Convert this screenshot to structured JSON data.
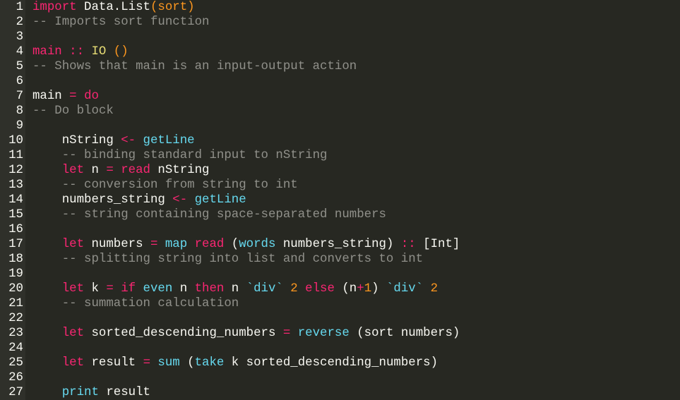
{
  "editor": {
    "line_numbers": [
      "1",
      "2",
      "3",
      "4",
      "5",
      "6",
      "7",
      "8",
      "9",
      "10",
      "11",
      "12",
      "13",
      "14",
      "15",
      "16",
      "17",
      "18",
      "19",
      "20",
      "21",
      "22",
      "23",
      "24",
      "25",
      "26",
      "27"
    ],
    "lines": [
      [
        {
          "t": "import",
          "c": "kw"
        },
        {
          "t": " Data.List",
          "c": "plain"
        },
        {
          "t": "(sort)",
          "c": "num"
        }
      ],
      [
        {
          "t": "-- Imports sort function",
          "c": "comment"
        }
      ],
      [],
      [
        {
          "t": "main",
          "c": "kw"
        },
        {
          "t": " :: ",
          "c": "op"
        },
        {
          "t": "IO",
          "c": "ty"
        },
        {
          "t": " ()",
          "c": "num"
        }
      ],
      [
        {
          "t": "-- Shows that main is an input-output action",
          "c": "comment"
        }
      ],
      [],
      [
        {
          "t": "main",
          "c": "plain"
        },
        {
          "t": " = ",
          "c": "op"
        },
        {
          "t": "do",
          "c": "kw"
        }
      ],
      [
        {
          "t": "-- Do block",
          "c": "comment"
        }
      ],
      [],
      [
        {
          "t": "    nString ",
          "c": "plain"
        },
        {
          "t": "<-",
          "c": "op"
        },
        {
          "t": " getLine",
          "c": "fn"
        }
      ],
      [
        {
          "t": "    -- binding standard input to nString",
          "c": "comment"
        }
      ],
      [
        {
          "t": "    let",
          "c": "kw"
        },
        {
          "t": " n ",
          "c": "plain"
        },
        {
          "t": "=",
          "c": "op"
        },
        {
          "t": " read",
          "c": "kw"
        },
        {
          "t": " nString",
          "c": "plain"
        }
      ],
      [
        {
          "t": "    -- conversion from string to int",
          "c": "comment"
        }
      ],
      [
        {
          "t": "    numbers_string ",
          "c": "plain"
        },
        {
          "t": "<-",
          "c": "op"
        },
        {
          "t": " getLine",
          "c": "fn"
        }
      ],
      [
        {
          "t": "    -- string containing space-separated numbers",
          "c": "comment"
        }
      ],
      [],
      [
        {
          "t": "    let",
          "c": "kw"
        },
        {
          "t": " numbers ",
          "c": "plain"
        },
        {
          "t": "=",
          "c": "op"
        },
        {
          "t": " map",
          "c": "fn"
        },
        {
          "t": " read",
          "c": "kw"
        },
        {
          "t": " (",
          "c": "plain"
        },
        {
          "t": "words",
          "c": "fn"
        },
        {
          "t": " numbers_string) ",
          "c": "plain"
        },
        {
          "t": "::",
          "c": "op"
        },
        {
          "t": " [Int]",
          "c": "plain"
        }
      ],
      [
        {
          "t": "    -- splitting string into list and converts to int",
          "c": "comment"
        }
      ],
      [],
      [
        {
          "t": "    let",
          "c": "kw"
        },
        {
          "t": " k ",
          "c": "plain"
        },
        {
          "t": "=",
          "c": "op"
        },
        {
          "t": " if",
          "c": "kw"
        },
        {
          "t": " even",
          "c": "fn"
        },
        {
          "t": " n ",
          "c": "plain"
        },
        {
          "t": "then",
          "c": "kw"
        },
        {
          "t": " n ",
          "c": "plain"
        },
        {
          "t": "`div`",
          "c": "fn"
        },
        {
          "t": " 2",
          "c": "num"
        },
        {
          "t": " else",
          "c": "kw"
        },
        {
          "t": " (n",
          "c": "plain"
        },
        {
          "t": "+",
          "c": "op"
        },
        {
          "t": "1",
          "c": "num"
        },
        {
          "t": ") ",
          "c": "plain"
        },
        {
          "t": "`div`",
          "c": "fn"
        },
        {
          "t": " 2",
          "c": "num"
        }
      ],
      [
        {
          "t": "    -- summation calculation",
          "c": "comment"
        }
      ],
      [],
      [
        {
          "t": "    let",
          "c": "kw"
        },
        {
          "t": " sorted_descending_numbers ",
          "c": "plain"
        },
        {
          "t": "=",
          "c": "op"
        },
        {
          "t": " reverse",
          "c": "fn"
        },
        {
          "t": " (sort numbers)",
          "c": "plain"
        }
      ],
      [],
      [
        {
          "t": "    let",
          "c": "kw"
        },
        {
          "t": " result ",
          "c": "plain"
        },
        {
          "t": "=",
          "c": "op"
        },
        {
          "t": " sum",
          "c": "fn"
        },
        {
          "t": " (",
          "c": "plain"
        },
        {
          "t": "take",
          "c": "fn"
        },
        {
          "t": " k sorted_descending_numbers)",
          "c": "plain"
        }
      ],
      [],
      [
        {
          "t": "    print",
          "c": "fn"
        },
        {
          "t": " result",
          "c": "plain"
        }
      ]
    ]
  }
}
